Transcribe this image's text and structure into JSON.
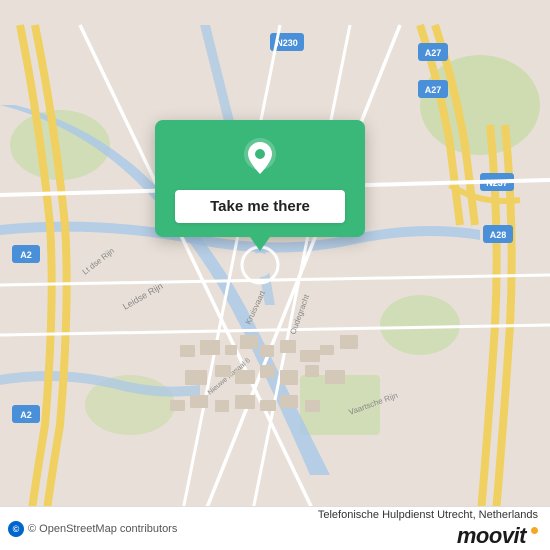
{
  "map": {
    "center_lat": 52.09,
    "center_lng": 5.12,
    "city": "Utrecht",
    "country": "Netherlands"
  },
  "popup": {
    "button_label": "Take me there",
    "pin_color": "#ffffff"
  },
  "bottom_bar": {
    "attribution": "© OpenStreetMap contributors",
    "osm_letter": "©",
    "location_name": "Telefonische Hulpdienst Utrecht, Netherlands",
    "moovit_label": "moovit"
  }
}
